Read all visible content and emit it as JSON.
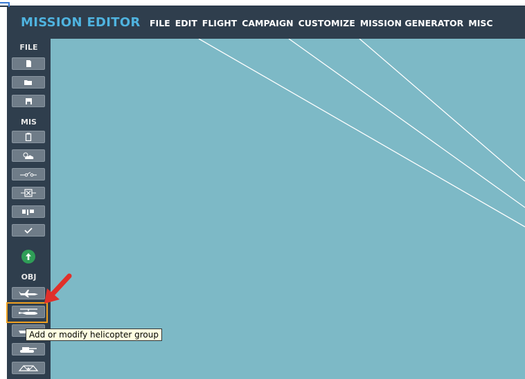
{
  "app": {
    "title": "MISSION EDITOR"
  },
  "menu": {
    "items": [
      "FILE",
      "EDIT",
      "FLIGHT",
      "CAMPAIGN",
      "CUSTOMIZE",
      "MISSION GENERATOR",
      "MISC"
    ]
  },
  "sidebar": {
    "file_label": "FILE",
    "mis_label": "MIS",
    "obj_label": "OBJ"
  },
  "tooltip": {
    "text": "Add or modify helicopter group"
  },
  "colors": {
    "map": "#7db9c6",
    "panel": "#2f3e4d",
    "title": "#4fb3df",
    "highlight": "#f0a020",
    "arrow": "#e0302a",
    "fly": "#2f9e57"
  },
  "icons": [
    "new-file-icon",
    "open-folder-icon",
    "save-icon",
    "briefing-icon",
    "weather-icon",
    "trigger-icon",
    "target-icon",
    "waypoints-icon",
    "check-icon",
    "fly-mission-icon",
    "airplane-icon",
    "helicopter-icon",
    "ship-icon",
    "ground-unit-icon",
    "static-icon"
  ]
}
